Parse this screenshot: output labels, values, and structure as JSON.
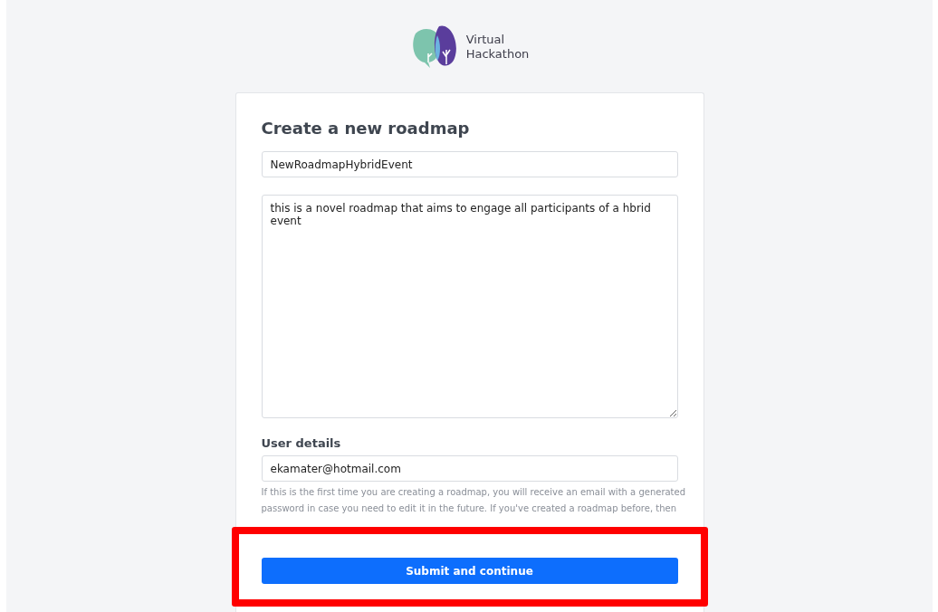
{
  "brand": {
    "name_line_1": "Virtual",
    "name_line_2": "Hackathon"
  },
  "form": {
    "title": "Create a new roadmap",
    "name_field": {
      "value": "NewRoadmapHybridEvent"
    },
    "description_field": {
      "value": "this is a novel roadmap that aims to engage all participants of a hbrid event"
    },
    "user_section": {
      "heading": "User details",
      "email_field": {
        "value": "ekamater@hotmail.com"
      },
      "help_text": "If this is the first time you are creating a roadmap, you will receive an email with a generated password in case you need to edit it in the future. If you've created a roadmap before, then"
    },
    "submit_button": {
      "label": "Submit and continue"
    }
  }
}
